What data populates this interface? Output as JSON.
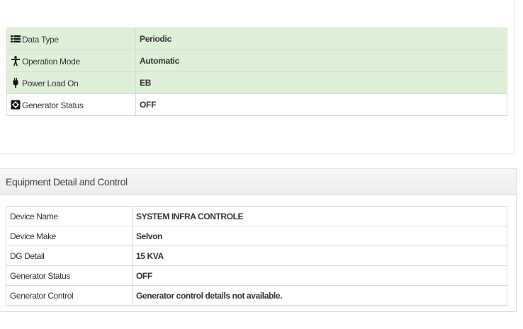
{
  "status": {
    "rows": [
      {
        "icon": "list-icon",
        "label": "Data Type",
        "value": "Periodic"
      },
      {
        "icon": "person-icon",
        "label": "Operation Mode",
        "value": "Automatic"
      },
      {
        "icon": "plug-icon",
        "label": "Power Load On",
        "value": "EB"
      },
      {
        "icon": "generator-icon",
        "label": "Generator Status",
        "value": "OFF"
      }
    ]
  },
  "equipment": {
    "heading": "Equipment Detail and Control",
    "rows": [
      {
        "label": "Device Name",
        "value": "SYSTEM INFRA CONTROLE"
      },
      {
        "label": "Device Make",
        "value": "Selvon"
      },
      {
        "label": "DG Detail",
        "value": "15 KVA"
      },
      {
        "label": "Generator Status",
        "value": "OFF"
      },
      {
        "label": "Generator Control",
        "value": "Generator control details not available."
      }
    ]
  },
  "colors": {
    "highlight_row": "#dff0d8",
    "border": "#d9d9d9"
  }
}
